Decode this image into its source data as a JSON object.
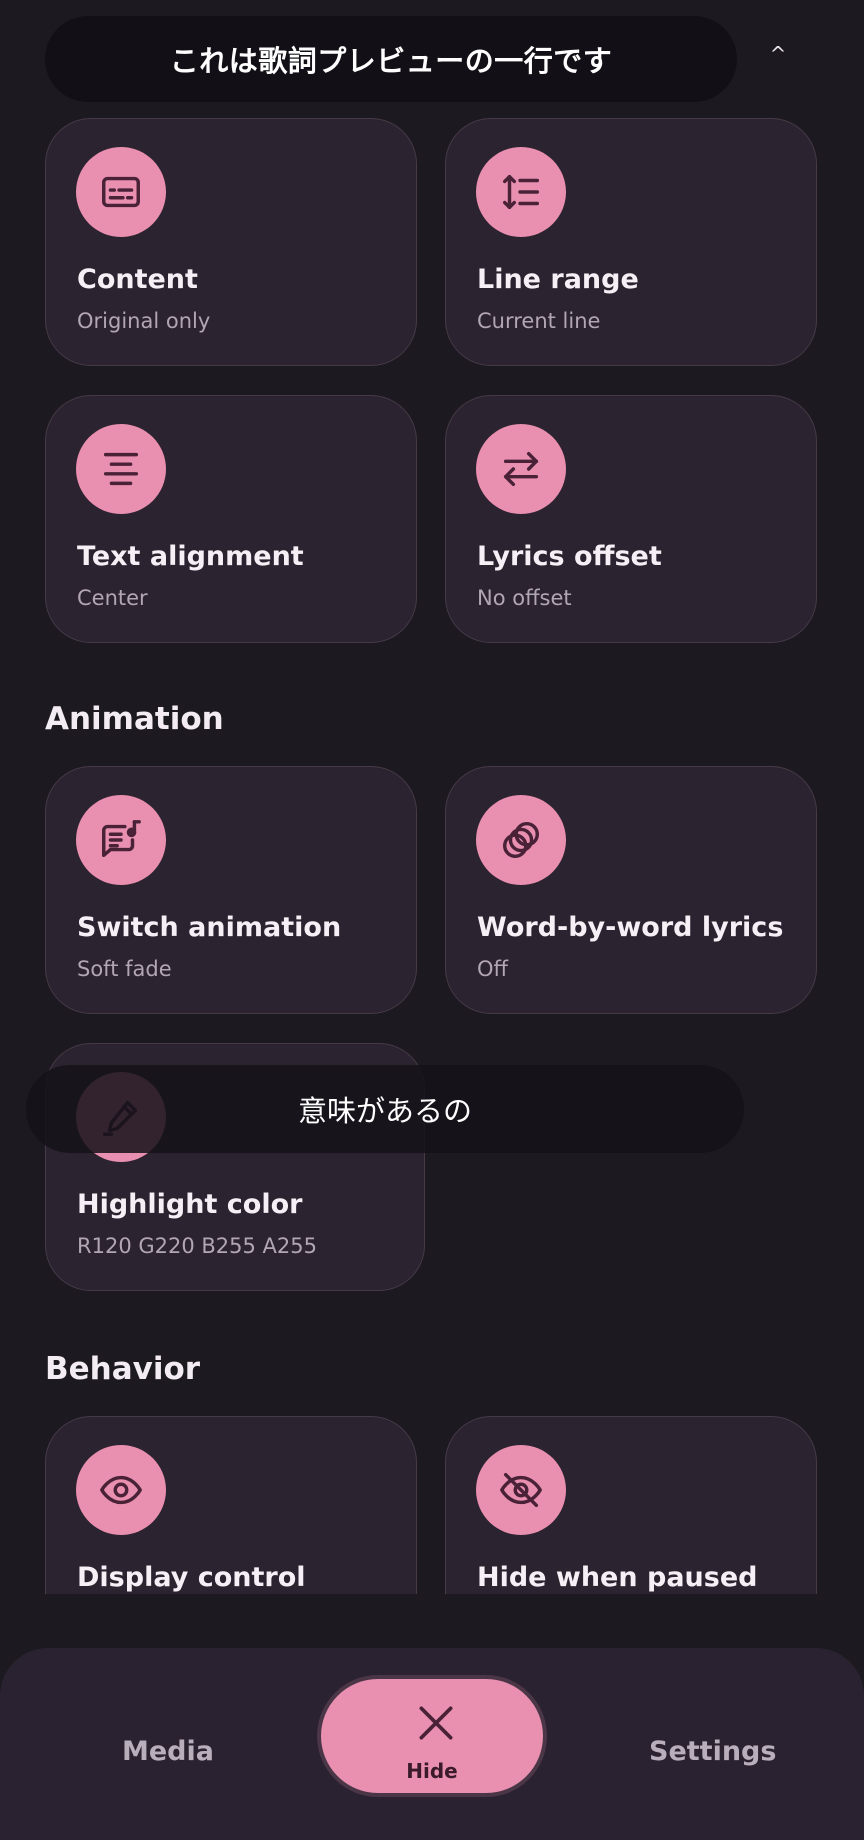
{
  "preview": {
    "text": "これは歌詞プレビューの一行です",
    "collapse_glyph": "^"
  },
  "colors": {
    "accent": "#e98faf",
    "card_bg": "#2c2330",
    "page_bg": "#1c1920",
    "icon_fg": "#4a2238"
  },
  "cards": [
    {
      "title": "Content",
      "subtitle": "Original only",
      "icon": "subtitles-icon"
    },
    {
      "title": "Line range",
      "subtitle": "Current line",
      "icon": "line-spacing-icon"
    },
    {
      "title": "Text alignment",
      "subtitle": "Center",
      "icon": "align-center-icon"
    },
    {
      "title": "Lyrics offset",
      "subtitle": "No offset",
      "icon": "swap-arrows-icon"
    },
    {
      "title": "Switch animation",
      "subtitle": "Soft fade",
      "icon": "lyrics-note-icon"
    },
    {
      "title": "Word-by-word lyrics",
      "subtitle": "Off",
      "icon": "circles-icon"
    },
    {
      "title": "Highlight color",
      "subtitle": "R120 G220 B255 A255",
      "icon": "pen-icon"
    },
    {
      "title": "Display control",
      "subtitle": "",
      "icon": "eye-icon"
    },
    {
      "title": "Hide when paused",
      "subtitle": "",
      "icon": "eye-off-icon"
    }
  ],
  "sections": {
    "animation": "Animation",
    "behavior": "Behavior"
  },
  "toast": {
    "text": "意味があるの"
  },
  "nav": {
    "media": "Media",
    "hide": "Hide",
    "settings": "Settings",
    "hide_icon": "close-icon"
  }
}
